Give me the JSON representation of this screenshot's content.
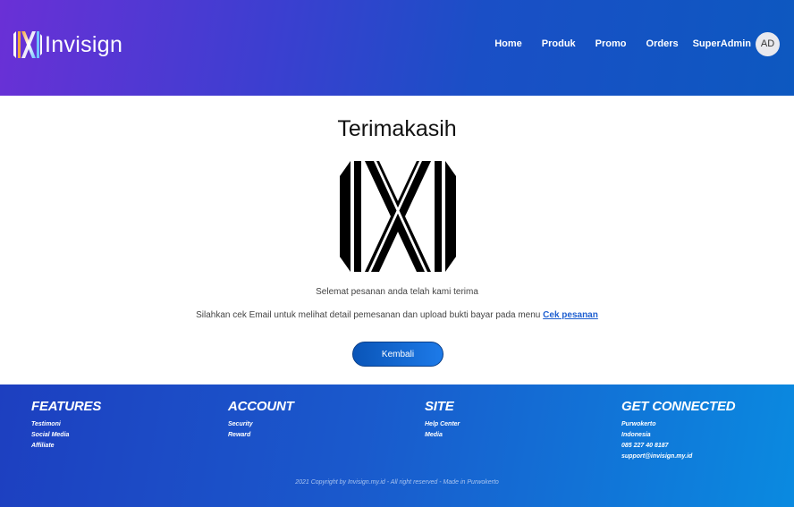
{
  "header": {
    "brand": "Invisign",
    "nav": [
      "Home",
      "Produk",
      "Promo",
      "Orders"
    ],
    "user": "SuperAdmin",
    "avatar_initials": "AD"
  },
  "main": {
    "title": "Terimakasih",
    "message1": "Selemat pesanan anda telah kami terima",
    "message2": "Silahkan cek Email untuk melihat detail pemesanan dan upload bukti bayar pada menu",
    "message2_link": "Cek pesanan",
    "back_button": "Kembali"
  },
  "footer": {
    "features": {
      "heading": "FEATURES",
      "items": [
        "Testimoni",
        "Social Media",
        "Affiliate"
      ]
    },
    "account": {
      "heading": "ACCOUNT",
      "items": [
        "Security",
        "Reward"
      ]
    },
    "site": {
      "heading": "SITE",
      "items": [
        "Help Center",
        "Media"
      ]
    },
    "connected": {
      "heading": "GET CONNECTED",
      "items": [
        "Purwokerto",
        "Indonesia",
        "085 227 40 8187",
        "support@invisign.my.id"
      ]
    },
    "copyright": "2021 Copyright by Invisign.my.id - All right reserved - Made in Purwokerto"
  },
  "colors": {
    "header_gradient": [
      "#6a30d6",
      "#0d58c0"
    ],
    "footer_gradient": [
      "#1d3fc0",
      "#0a8ae0"
    ],
    "button": "#0a55b8",
    "link": "#1e5fd0"
  }
}
